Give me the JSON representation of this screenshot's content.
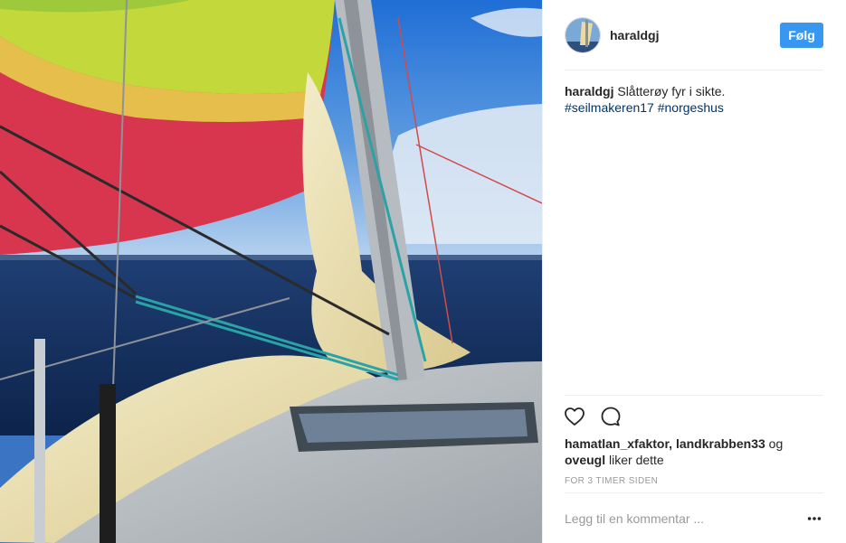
{
  "post": {
    "username": "haraldgj",
    "follow_label": "Følg",
    "caption_user": "haraldgj",
    "caption_text": "Slåtterøy fyr i sikte.",
    "hashtags": [
      "#seilmakeren17",
      "#norgeshus"
    ],
    "likes": {
      "user1": "hamatlan_xfaktor",
      "user2": "landkrabben33",
      "connector": "og",
      "user3": "oveugl",
      "suffix": "liker dette"
    },
    "timestamp": "FOR 3 TIMER SIDEN",
    "comment_placeholder": "Legg til en kommentar ..."
  },
  "icons": {
    "like": "heart-icon",
    "comment": "comment-bubble-icon",
    "more": "more-options-icon"
  },
  "colors": {
    "follow_button": "#3897f0",
    "hashtag": "#003569",
    "muted_text": "#999999"
  }
}
